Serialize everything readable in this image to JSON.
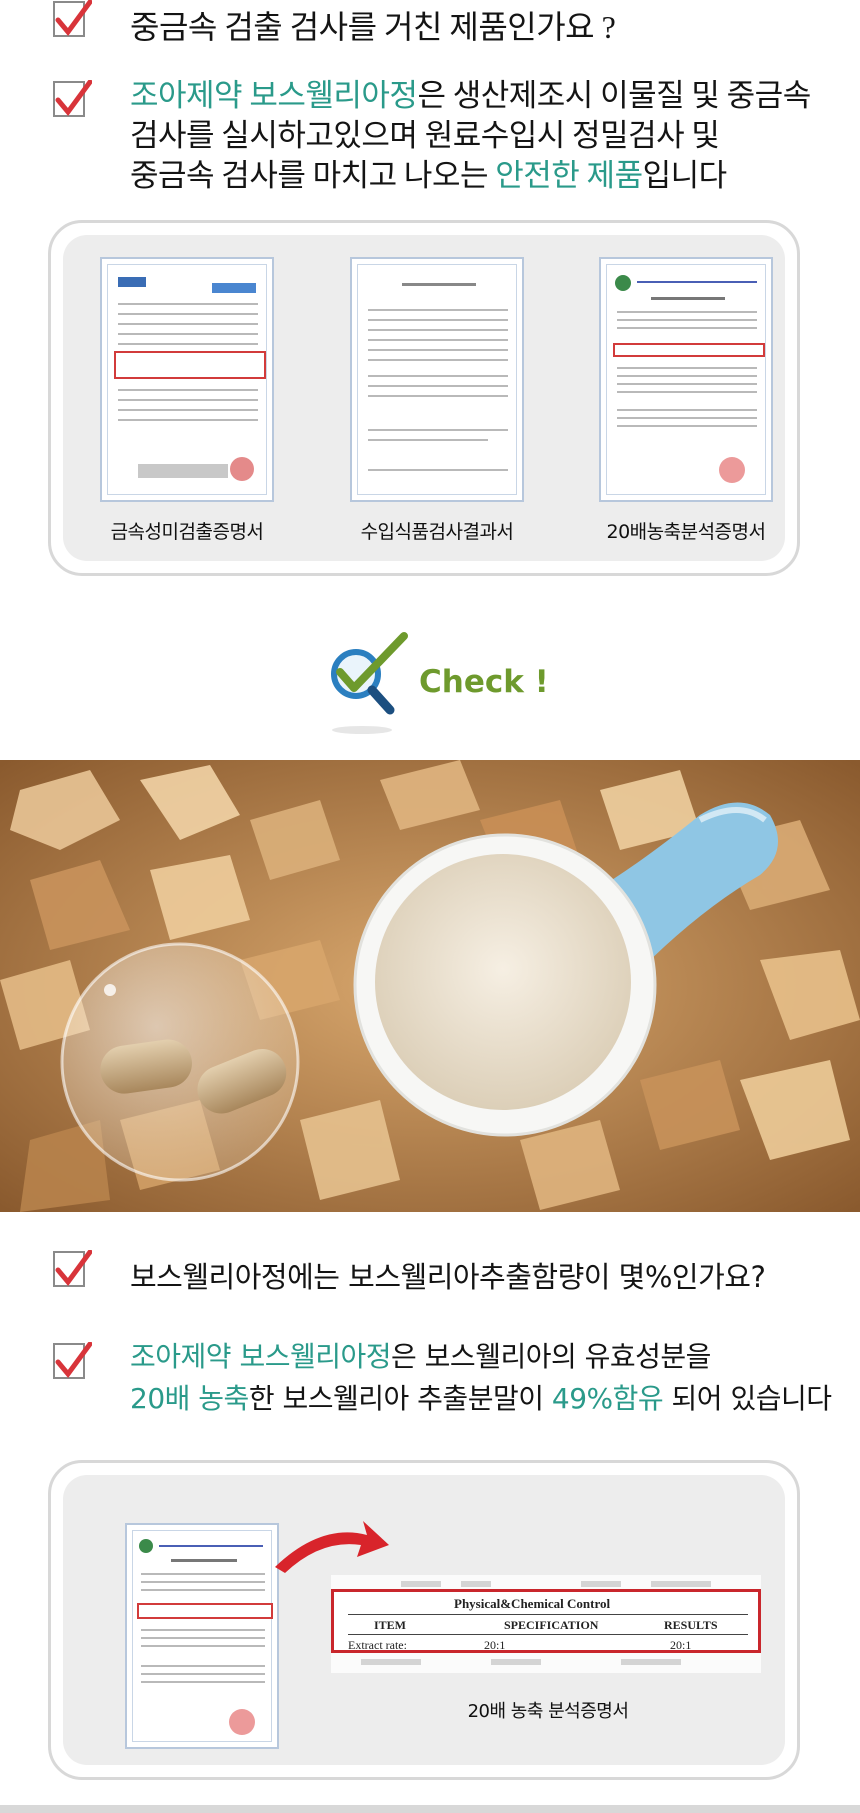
{
  "section1": {
    "question": "중금속 검출 검사를 거친 제품인가요 ?",
    "answer": {
      "brand": "조아제약 보스웰리아정",
      "line1_rest": "은 생산제조시 이물질 및 중금속",
      "line2": "검사를  실시하고있으며 원료수입시 정밀검사 및",
      "line3_pre": "중금속 검사를 마치고 나오는 ",
      "line3_highlight": "안전한 제품",
      "line3_post": "입니다"
    },
    "certificates": [
      {
        "caption": "금속성미검출증명서"
      },
      {
        "caption": "수입식품검사결과서"
      },
      {
        "caption": "20배농축분석증명서"
      }
    ]
  },
  "check_badge": {
    "text": "Check !",
    "icon": "magnifier-check-icon"
  },
  "section2": {
    "question": "보스웰리아정에는 보스웰리아추출함량이 몇%인가요?",
    "answer": {
      "brand": "조아제약 보스웰리아정",
      "line1_rest": "은  보스웰리아의 유효성분을",
      "line2_highlight1": "20배 농축",
      "line2_mid": "한 보스웰리아 추출분말이 ",
      "line2_highlight2": "49%함유",
      "line2_post": " 되어 있습니다"
    },
    "zoom_table": {
      "title": "Physical&Chemical Control",
      "headers": [
        "ITEM",
        "SPECIFICATION",
        "RESULTS"
      ],
      "row_label": "Extract rate:",
      "row_spec": "20:1",
      "row_result": "20:1"
    },
    "caption": "20배 농축 분석증명서"
  },
  "colors": {
    "highlight": "#2a9a8a",
    "check_red": "#d8343a",
    "check_green": "#6e9a2d",
    "cert_red": "#c9262c"
  }
}
